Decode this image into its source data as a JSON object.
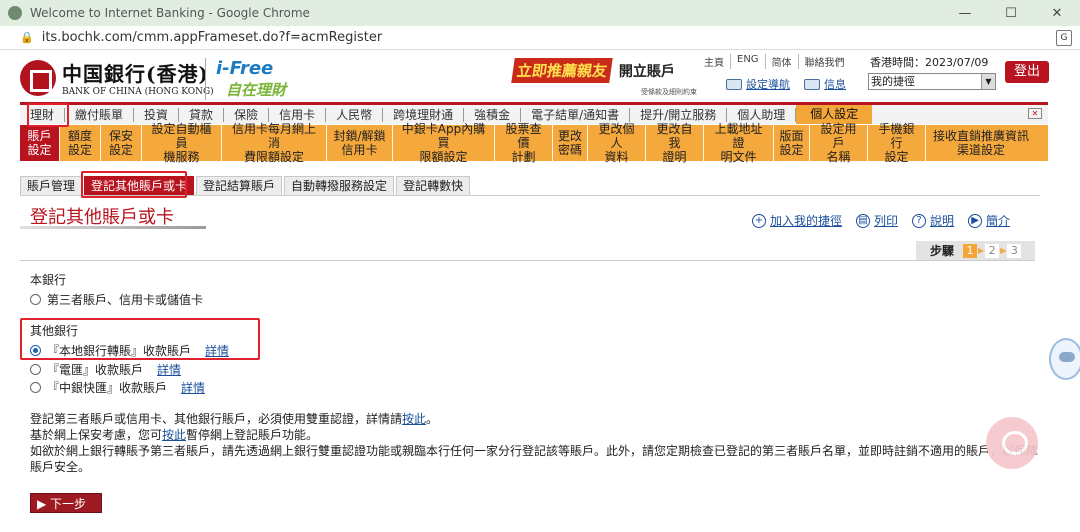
{
  "window": {
    "title": "Welcome to Internet Banking - Google Chrome",
    "url": "its.bochk.com/cmm.appFrameset.do?f=acmRegister",
    "controls": [
      "—",
      "☐",
      "✕"
    ]
  },
  "header": {
    "bank_name_cn": "中国銀行(香港)",
    "bank_name_en": "BANK OF CHINA (HONG KONG)",
    "brand_i": "i-Free",
    "brand_cn": "自在理財",
    "promo_main": "立即推薦親友",
    "promo_sub": "開立賬戶",
    "promo_note": "受條款及細則約束",
    "top_links": [
      "主頁",
      "ENG",
      "简体",
      "聯絡我們"
    ],
    "hk_time_label": "香港時間：2023/07/09",
    "setting_nav": "設定導航",
    "messages": "信息",
    "shortcut_select": "我的捷徑",
    "logout": "登出"
  },
  "main_menu": {
    "items": [
      "理財",
      "繳付賬單",
      "投資",
      "貸款",
      "保險",
      "信用卡",
      "人民幣",
      "跨境理財通",
      "強積金",
      "電子結單/通知書",
      "提升/開立服務",
      "個人助理",
      "個人設定"
    ],
    "active_index": 12
  },
  "sub_menu": {
    "items": [
      "賬戶\n設定",
      "額度\n設定",
      "保安\n設定",
      "設定自動櫃員\n機服務",
      "信用卡每月網上消\n費限額設定",
      "封鎖/解鎖\n信用卡",
      "中銀卡App內購買\n限額設定",
      "股票查價\n計劃",
      "更改\n密碼",
      "更改個人\n資料",
      "更改自我\n證明",
      "上載地址證\n明文件",
      "版面\n設定",
      "設定用戶\n名稱",
      "手機銀行\n設定",
      "接收直銷推廣資訊\n渠道設定"
    ],
    "active_index": 0
  },
  "tabs": {
    "items": [
      "賬戶管理",
      "登記其他賬戶或卡",
      "登記結算賬戶",
      "自動轉撥服務設定",
      "登記轉數快"
    ],
    "active_index": 1
  },
  "page": {
    "title": "登記其他賬戶或卡",
    "actions": {
      "favorite": "加入我的捷徑",
      "print": "列印",
      "help": "說明",
      "demo": "簡介"
    },
    "step_label": "步驟",
    "steps": [
      "1",
      "2",
      "3"
    ],
    "current_step": 1
  },
  "form": {
    "section_own": "本銀行",
    "opt_third_party": "第三者賬戶、信用卡或儲值卡",
    "section_other": "其他銀行",
    "opt_local_transfer": "『本地銀行轉賬』收款賬戶",
    "opt_telegraphic": "『電匯』收款賬戶",
    "opt_boc_fast": "『中銀快匯』收款賬戶",
    "details": "詳情",
    "selected": "opt_local_transfer"
  },
  "notes": {
    "line1_a": "登記第三者賬戶或信用卡、其他銀行賬戶，必須使用雙重認證，詳情請",
    "line1_link": "按此",
    "line1_b": "。",
    "line2_a": "基於網上保安考慮，您可",
    "line2_link": "按此",
    "line2_b": "暫停網上登記賬戶功能。",
    "line3": "如欲於網上銀行轉賬予第三者賬戶，請先透過網上銀行雙重認證功能或親臨本行任何一家分行登記該等賬戶。此外，請您定期檢查已登記的第三者賬戶名單，並即時註銷不適用的賬戶，以保障賬戶安全。"
  },
  "next_button": "下一步",
  "colors": {
    "brand_red": "#b8141f",
    "menu_orange": "#f5a83c",
    "link_blue": "#1b4f9c",
    "highlight_box": "#e0202a"
  }
}
